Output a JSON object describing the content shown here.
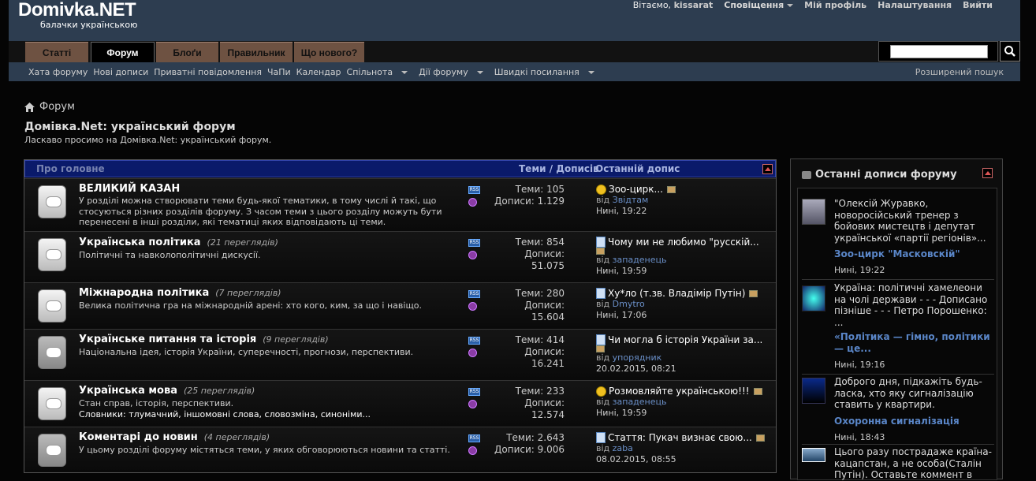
{
  "logo": {
    "name": "Domivka.NET",
    "tagline": "балачки українською"
  },
  "topnav": {
    "welcome": "Вітаємо,",
    "user": "kissarat",
    "notifications": "Сповіщення",
    "profile": "Мій профіль",
    "settings": "Налаштування",
    "logout": "Вийти"
  },
  "tabs": [
    "Статті",
    "Форум",
    "Блоґи",
    "Правильник",
    "Що нового?"
  ],
  "subnav": [
    "Хата форуму",
    "Нові дописи",
    "Приватні повідомлення",
    "ЧаПи",
    "Календар",
    "Спільнота",
    "Дії форуму",
    "Швидкі посилання"
  ],
  "advanced_search": "Розширений пошук",
  "breadcrumb": "Форум",
  "page_title": "Домівка.Net: український форум",
  "page_subtitle": "Ласкаво просимо на Домівка.Net: український форум.",
  "forum_header": {
    "name": "Про головне",
    "stats": "Теми / Дописів",
    "last": "Останній допис"
  },
  "forums": [
    {
      "name": "ВЕЛИКИЙ КАЗАН",
      "views": "",
      "desc": "У розділі можна створювати теми будь-якої тематики, в тому числі й такі, що стосуються різних розділів форуму. З часом теми з цього розділу можуть бути перенесені в інші розділи, які тематиці яких відповідають ці теми.",
      "topics": "Теми: 105",
      "posts": "Дописи: 1.129",
      "last_title": "Зоо-цирк...",
      "last_by": "від",
      "last_user": "Звідтам",
      "last_date": "Нині, 19:22"
    },
    {
      "name": "Українська політика",
      "views": "(21 переглядів)",
      "desc": "Політичні та навколополітичні дискусії.",
      "topics": "Теми: 854",
      "posts": "Дописи:",
      "posts2": "51.075",
      "last_title": "Чому ми не любимо \"русскій...",
      "last_by": "від",
      "last_user": "западенець",
      "last_date": "Нині, 19:59"
    },
    {
      "name": "Міжнародна політика",
      "views": "(7 переглядів)",
      "desc": "Велика політична гра на міжнародній арені: хто кого, ким, за що і навіщо.",
      "topics": "Теми: 280",
      "posts": "Дописи:",
      "posts2": "15.604",
      "last_title": "Ху*ло (т.зв. Владімір Путін)",
      "last_by": "від",
      "last_user": "Dmytro",
      "last_date": "Нині, 17:06"
    },
    {
      "name": "Українське питання та історія",
      "views": "(9 переглядів)",
      "desc": "Національна ідея, історія України, суперечності, прогнози, перспективи.",
      "topics": "Теми: 414",
      "posts": "Дописи:",
      "posts2": "16.241",
      "last_title": "Чи могла б історія України за...",
      "last_by": "від",
      "last_user": "упорядник",
      "last_date": "20.02.2015, 08:21"
    },
    {
      "name": "Українська мова",
      "views": "(25 переглядів)",
      "desc": "Стан справ, історія, перспективи.",
      "desc2": "Словники: тлумачний, іншомовні слова, словозміна, синоніми...",
      "topics": "Теми: 233",
      "posts": "Дописи:",
      "posts2": "12.574",
      "last_title": "Розмовляйте українською!!!",
      "last_by": "від",
      "last_user": "западенець",
      "last_date": "Нині, 19:59"
    },
    {
      "name": "Коментарі до новин",
      "views": "(4 переглядів)",
      "desc": "У цьому розділі форуму містяться теми, у яких обговорюються новини та статті.",
      "topics": "Теми: 2.643",
      "posts": "Дописи: 9.006",
      "last_title": "Стаття: Пукач визнає свою...",
      "last_by": "від",
      "last_user": "zaba",
      "last_date": "08.02.2015, 08:55"
    }
  ],
  "recent": {
    "title": "Останні дописи форуму",
    "items": [
      {
        "text": "\"Олексій Журавко, новоросійський тренер з бойових мистецтв і депутат української «партії регіонів»...",
        "link": "Зоо-цирк \"Масковскій\"",
        "date": "Нині, 19:22"
      },
      {
        "text": "Україна: політичні хамелеони на чолі держави - - - Дописано пізніше - - - Петро Порошенко: ...",
        "link": "«Політика — гімно, політики — це...",
        "date": "Нині, 19:16"
      },
      {
        "text": "Доброго дня, підкажіть будь-ласка, хто яку сигналізацію ставить у квартири.",
        "link": "Охоронна сигналізація",
        "date": "Нині, 18:43"
      },
      {
        "text": "Цього разу пострадаже країна-кацапстан, а не особа(Сталін Путін). Оставьте коммент в",
        "link": "",
        "date": ""
      }
    ]
  },
  "colors": {
    "header": "#2d3d50",
    "tab": "#6e5242",
    "forum_head": "#0a1a6a",
    "link": "#5a86c8"
  }
}
